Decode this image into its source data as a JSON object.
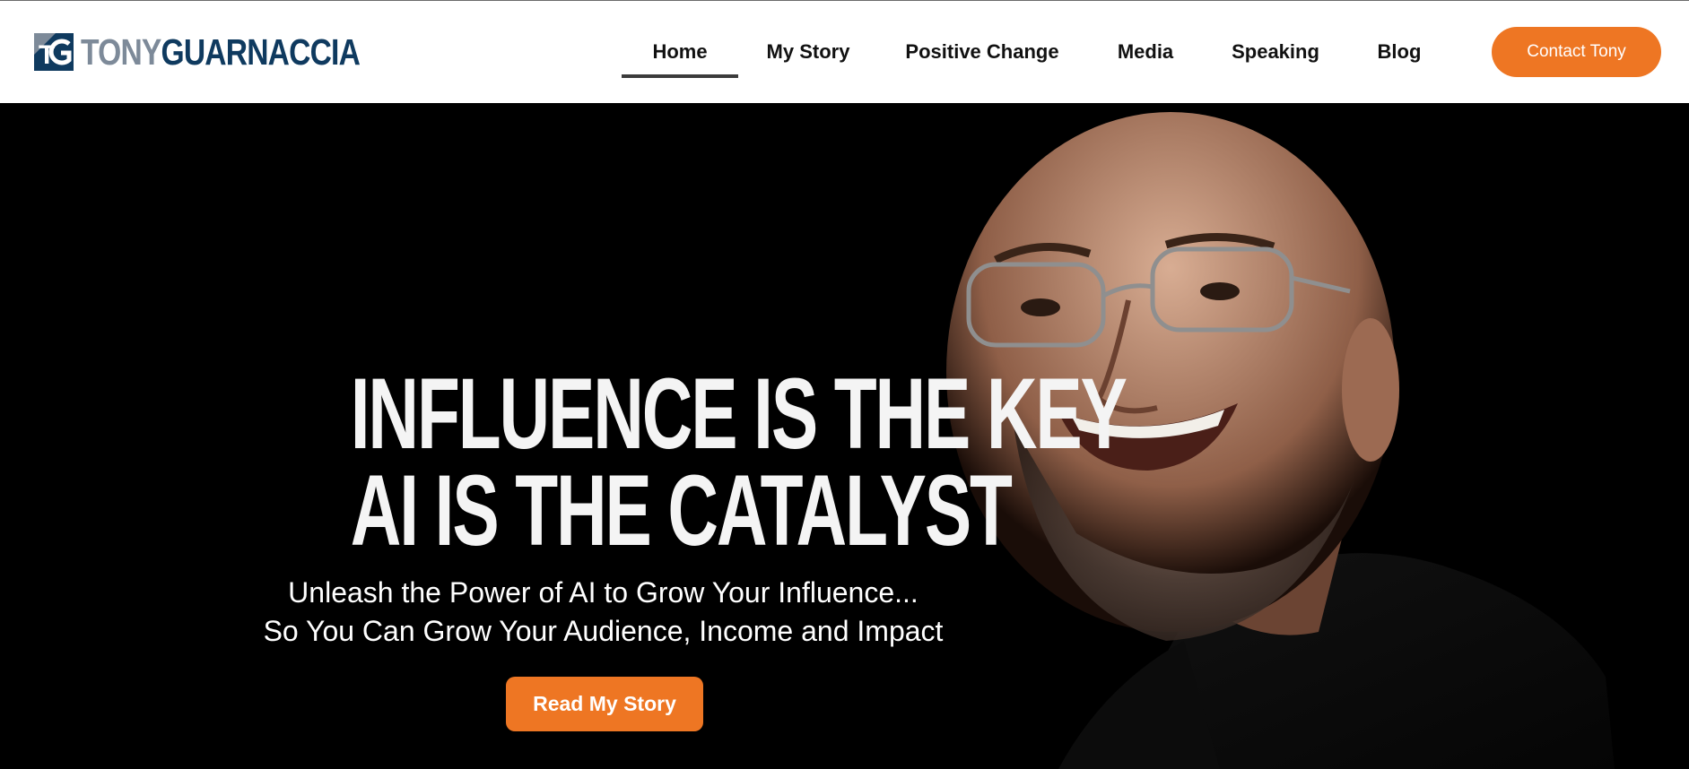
{
  "brand": {
    "first_name": "TONY",
    "last_name": "GUARNACCIA",
    "logo_icon": "tg-monogram-icon",
    "colors": {
      "first": "#7d8a99",
      "last": "#0f3a5f"
    }
  },
  "nav": {
    "items": [
      {
        "label": "Home",
        "active": true
      },
      {
        "label": "My Story"
      },
      {
        "label": "Positive Change"
      },
      {
        "label": "Media"
      },
      {
        "label": "Speaking"
      },
      {
        "label": "Blog"
      }
    ],
    "cta": "Contact Tony"
  },
  "hero": {
    "headline_line1": "INFLUENCE IS THE KEY",
    "headline_line2": "AI IS THE CATALYST",
    "subtitle_line1": "Unleash the Power of AI to Grow Your Influence...",
    "subtitle_line2": "So You Can Grow Your Audience, Income and Impact",
    "button": "Read My Story"
  },
  "colors": {
    "accent": "#ee7623",
    "hero_bg": "#000000",
    "nav_text": "#111111"
  }
}
